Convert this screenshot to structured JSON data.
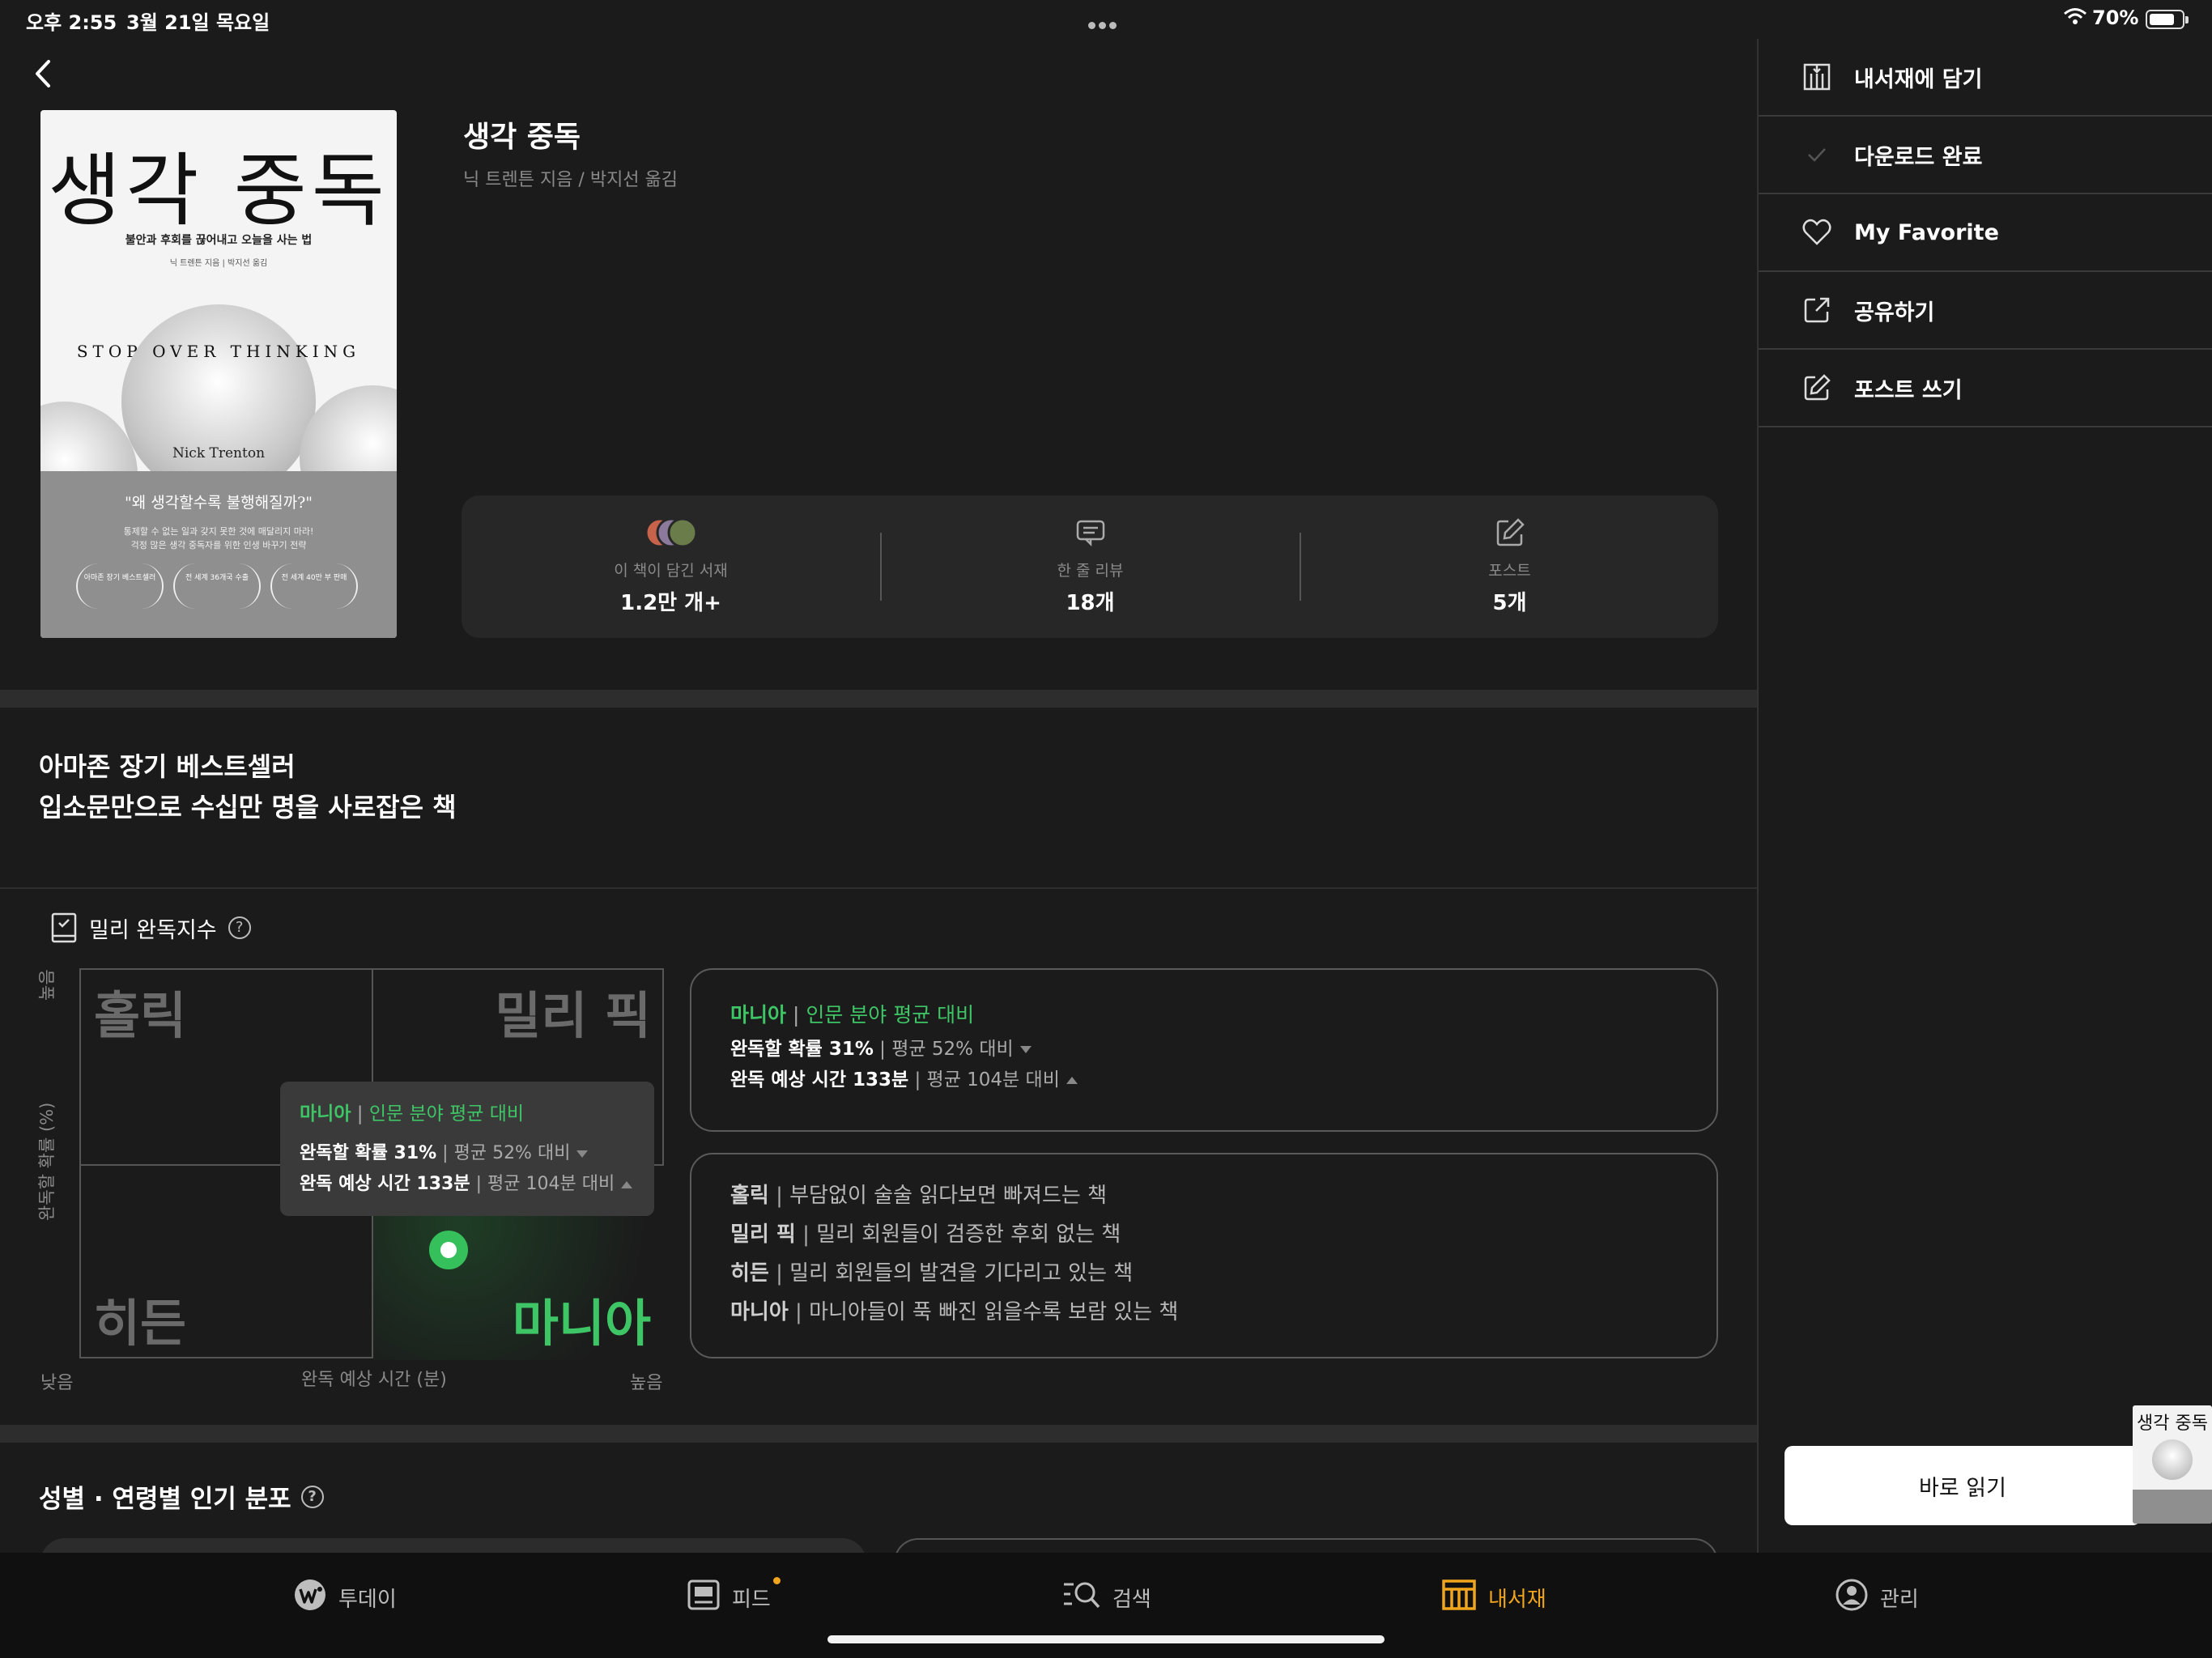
{
  "status": {
    "time": "오후 2:55",
    "date": "3월 21일 목요일",
    "battery": "70%"
  },
  "book": {
    "title": "생각 중독",
    "author": "닉 트렌튼 지음 / 박지선 옮김",
    "cover": {
      "title": "생각 중독",
      "subtitle": "불안과 후회를 끊어내고 오늘을 사는 법",
      "credits": "닉 트렌튼 지음 | 박지선 옮김",
      "english_title": "STOP OVER THINKING",
      "english_author": "Nick Trenton",
      "quote": "\"왜 생각할수록 불행해질까?\"",
      "blurb_1": "통제할 수 없는 일과 갖지 못한 것에 매달리지 마라!",
      "blurb_2": "걱정 많은 생각 중독자를 위한 인생 바꾸기 전략",
      "badges": [
        "아마존 장기 베스트셀러",
        "전 세계 36개국 수출",
        "전 세계 40만 부 판매"
      ]
    }
  },
  "stats": [
    {
      "label": "이 책이 담긴 서재",
      "value": "1.2만 개+"
    },
    {
      "label": "한 줄 리뷰",
      "value": "18개"
    },
    {
      "label": "포스트",
      "value": "5개"
    }
  ],
  "headline": {
    "line1": "아마존 장기 베스트셀러",
    "line2": "입소문만으로 수십만 명을 사로잡은 책"
  },
  "completion": {
    "title": "밀리 완독지수",
    "quadrants": {
      "top_left": "홀릭",
      "top_right": "밀리 픽",
      "bottom_left": "히든",
      "bottom_right": "마니아"
    },
    "y_axis": "완독할 확률 (%)",
    "y_high": "높음",
    "x_axis": "완독 예상 시간 (분)",
    "x_low": "낮음",
    "x_high": "높음",
    "category": "마니아",
    "comparison": "인문 분야 평균 대비",
    "prob_label": "완독할 확률 31%",
    "prob_avg": "평균 52% 대비",
    "time_label": "완독 예상 시간 133분",
    "time_avg": "평균 104분 대비",
    "legend": [
      {
        "name": "홀릭",
        "desc": "부담없이 술술 읽다보면 빠져드는 책"
      },
      {
        "name": "밀리 픽",
        "desc": "밀리 회원들이 검증한 후회 없는 책"
      },
      {
        "name": "히든",
        "desc": "밀리 회원들의 발견을 기다리고 있는 책"
      },
      {
        "name": "마니아",
        "desc": "마니아들이 푹 빠진 읽을수록 보람 있는 책"
      }
    ]
  },
  "distribution": {
    "title": "성별 · 연령별 인기 분포"
  },
  "side_menu": [
    {
      "label": "내서재에 담기",
      "icon": "bookshelf-add-icon"
    },
    {
      "label": "다운로드 완료",
      "icon": "check-icon"
    },
    {
      "label": "My Favorite",
      "icon": "heart-icon"
    },
    {
      "label": "공유하기",
      "icon": "share-icon"
    },
    {
      "label": "포스트 쓰기",
      "icon": "edit-icon"
    }
  ],
  "read_button": "바로 읽기",
  "tabs": [
    {
      "label": "투데이",
      "icon": "today-icon"
    },
    {
      "label": "피드",
      "icon": "feed-icon"
    },
    {
      "label": "검색",
      "icon": "search-icon"
    },
    {
      "label": "내서재",
      "icon": "library-icon",
      "active": true
    },
    {
      "label": "관리",
      "icon": "profile-icon"
    }
  ],
  "colors": {
    "accent": "#f0a51c",
    "green": "#3ec565",
    "bg": "#1b1b1b"
  }
}
